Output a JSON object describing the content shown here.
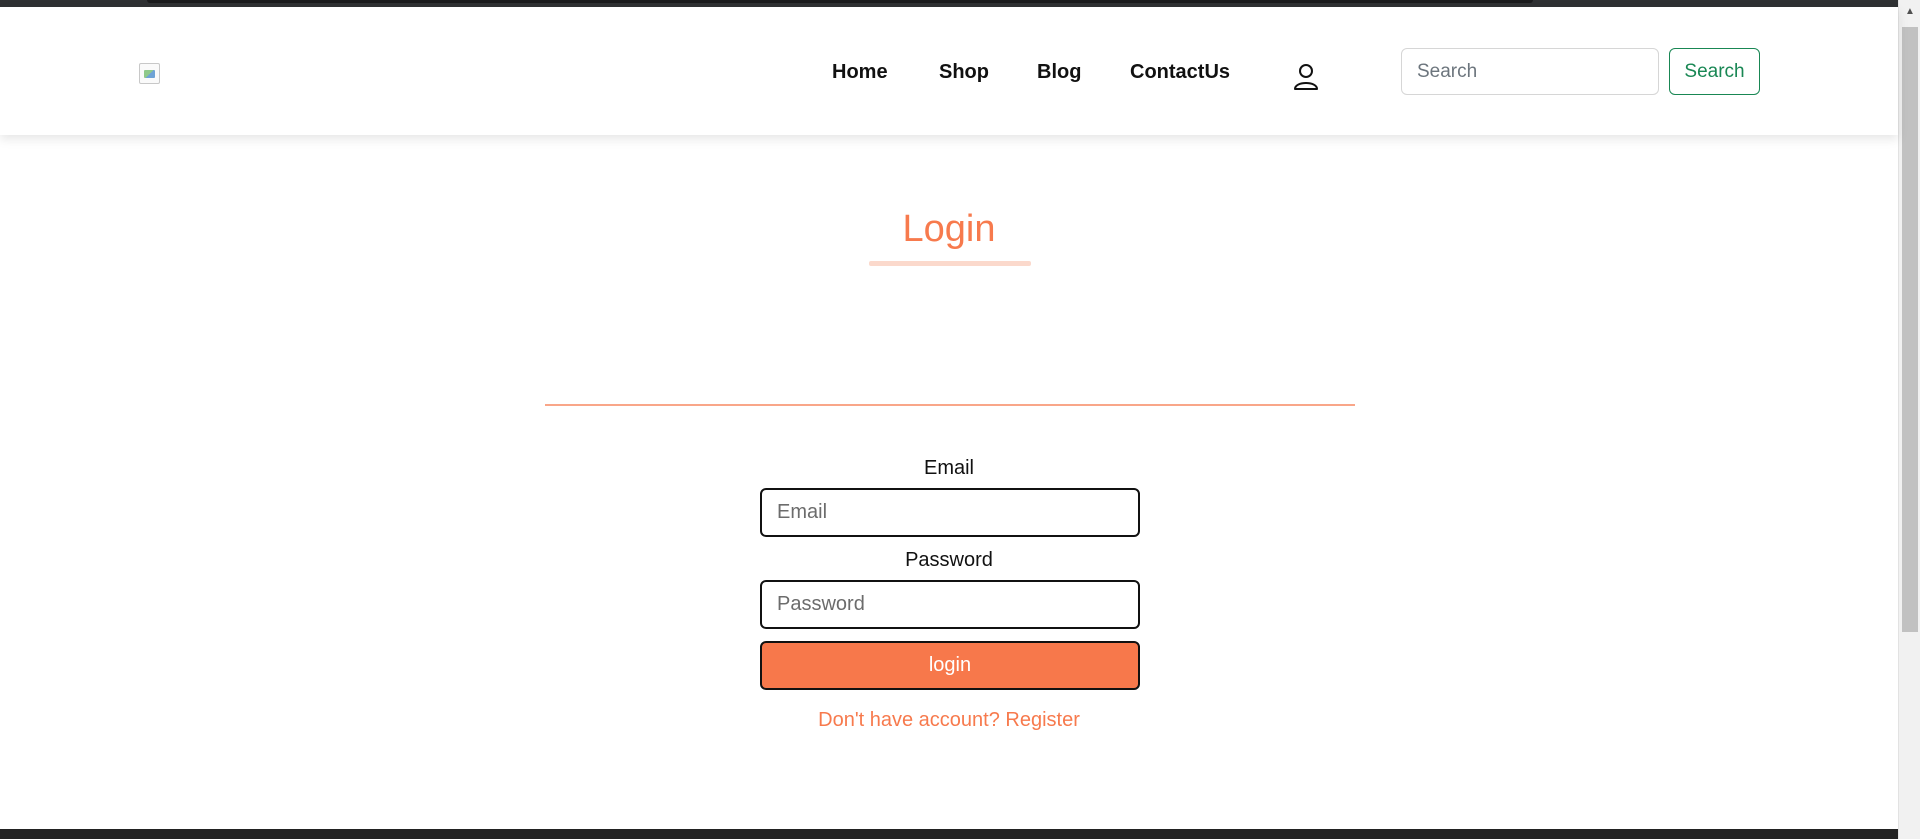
{
  "navbar": {
    "links": [
      {
        "label": "Home"
      },
      {
        "label": "Shop"
      },
      {
        "label": "Blog"
      },
      {
        "label": "ContactUs"
      }
    ],
    "search": {
      "placeholder": "Search",
      "button_label": "Search"
    },
    "icons": {
      "logo": "broken-image-icon",
      "account": "user-icon"
    }
  },
  "login": {
    "title": "Login",
    "email": {
      "label": "Email",
      "placeholder": "Email"
    },
    "password": {
      "label": "Password",
      "placeholder": "Password"
    },
    "submit_label": "login",
    "register_link": "Don't have account? Register"
  },
  "colors": {
    "accent": "#f77a4d",
    "search_button": "#198754"
  }
}
